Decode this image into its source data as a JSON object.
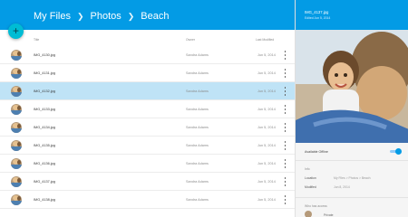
{
  "breadcrumb": [
    "My Files",
    "Photos",
    "Beach"
  ],
  "fab": {
    "icon": "plus-icon",
    "label": "+"
  },
  "columns": {
    "title": "Title",
    "owner": "Owner",
    "modified": "Last Modified"
  },
  "rows": [
    {
      "name": "IMG_4130.jpg",
      "owner": "Sandra Adams",
      "date": "Jun 5, 2014",
      "selected": false
    },
    {
      "name": "IMG_4131.jpg",
      "owner": "Sandra Adams",
      "date": "Jun 5, 2014",
      "selected": false
    },
    {
      "name": "IMG_4132.jpg",
      "owner": "Sandra Adams",
      "date": "Jun 5, 2014",
      "selected": true
    },
    {
      "name": "IMG_4133.jpg",
      "owner": "Sandra Adams",
      "date": "Jun 5, 2014",
      "selected": false
    },
    {
      "name": "IMG_4134.jpg",
      "owner": "Sandra Adams",
      "date": "Jun 5, 2014",
      "selected": false
    },
    {
      "name": "IMG_4135.jpg",
      "owner": "Sandra Adams",
      "date": "Jun 5, 2014",
      "selected": false
    },
    {
      "name": "IMG_4136.jpg",
      "owner": "Sandra Adams",
      "date": "Jun 5, 2014",
      "selected": false
    },
    {
      "name": "IMG_4137.jpg",
      "owner": "Sandra Adams",
      "date": "Jun 5, 2014",
      "selected": false
    },
    {
      "name": "IMG_4138.jpg",
      "owner": "Sandra Adams",
      "date": "Jun 5, 2014",
      "selected": false
    }
  ],
  "panel": {
    "title": "IMG_4137.jpg",
    "subtitle": "Edited Jun 5, 2014",
    "available_offline_label": "Available Offline",
    "available_offline": true,
    "info_title": "Info",
    "location_label": "Location",
    "location_value": "My Files > Photos > Beach",
    "modified_label": "Modified",
    "modified_value": "Jun 8, 2014",
    "access_title": "Who has access",
    "access_name": "Private"
  },
  "colors": {
    "header": "#039be5",
    "fab": "#00bcd4",
    "selected_row": "#bfe3f6"
  }
}
